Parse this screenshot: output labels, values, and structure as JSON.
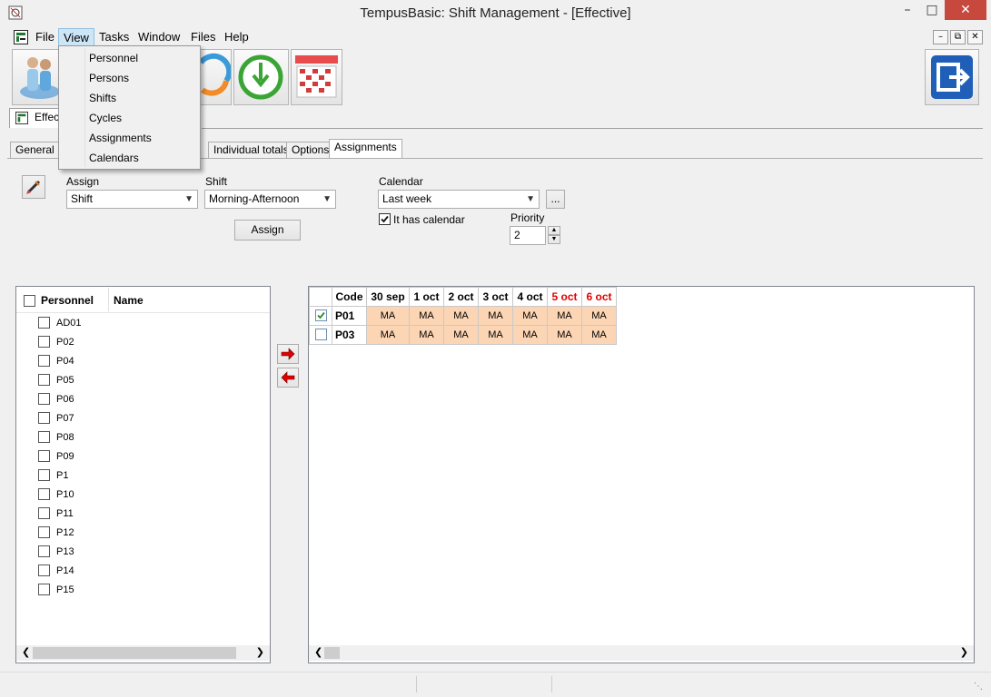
{
  "window": {
    "title": "TempusBasic: Shift Management - [Effective]",
    "minimize": "–",
    "maximize": "□",
    "close": "✕"
  },
  "menu": {
    "items": [
      "File",
      "View",
      "Tasks",
      "Window",
      "Files",
      "Help"
    ],
    "mdi_controls": [
      "–",
      "⧉",
      "✕"
    ]
  },
  "view_menu": {
    "items": [
      "Personnel",
      "Persons",
      "Shifts",
      "Cycles",
      "Assignments",
      "Calendars"
    ]
  },
  "doc_tab": {
    "label": "Effec"
  },
  "tabs": [
    "General",
    "Individual totals",
    "Options",
    "Assignments"
  ],
  "active_tab": "Assignments",
  "form": {
    "assign_label": "Assign",
    "assign_value": "Shift",
    "shift_label": "Shift",
    "shift_value": "Morning-Afternoon",
    "assign_button": "Assign",
    "calendar_label": "Calendar",
    "calendar_value": "Last week",
    "ellipsis_button": "...",
    "has_calendar_label": "It has calendar",
    "has_calendar_checked": true,
    "priority_label": "Priority",
    "priority_value": "2"
  },
  "personnel_list": {
    "headers": [
      "Personnel",
      "Name"
    ],
    "items": [
      "AD01",
      "P02",
      "P04",
      "P05",
      "P06",
      "P07",
      "P08",
      "P09",
      "P1",
      "P10",
      "P11",
      "P12",
      "P13",
      "P14",
      "P15"
    ]
  },
  "grid": {
    "headers": [
      "Code",
      "30 sep",
      "1 oct",
      "2 oct",
      "3 oct",
      "4 oct",
      "5 oct",
      "6 oct"
    ],
    "weekend_headers": [
      "5 oct",
      "6 oct"
    ],
    "rows": [
      {
        "checked": true,
        "code": "P01",
        "values": [
          "MA",
          "MA",
          "MA",
          "MA",
          "MA",
          "MA",
          "MA"
        ]
      },
      {
        "checked": false,
        "code": "P03",
        "values": [
          "MA",
          "MA",
          "MA",
          "MA",
          "MA",
          "MA",
          "MA"
        ]
      }
    ],
    "cell_color": "#fcd5b4",
    "weekend_color": "#e00000"
  },
  "colors": {
    "close_button": "#c7483c",
    "menu_highlight": "#cde6f7",
    "arrow_red": "#e00000"
  }
}
